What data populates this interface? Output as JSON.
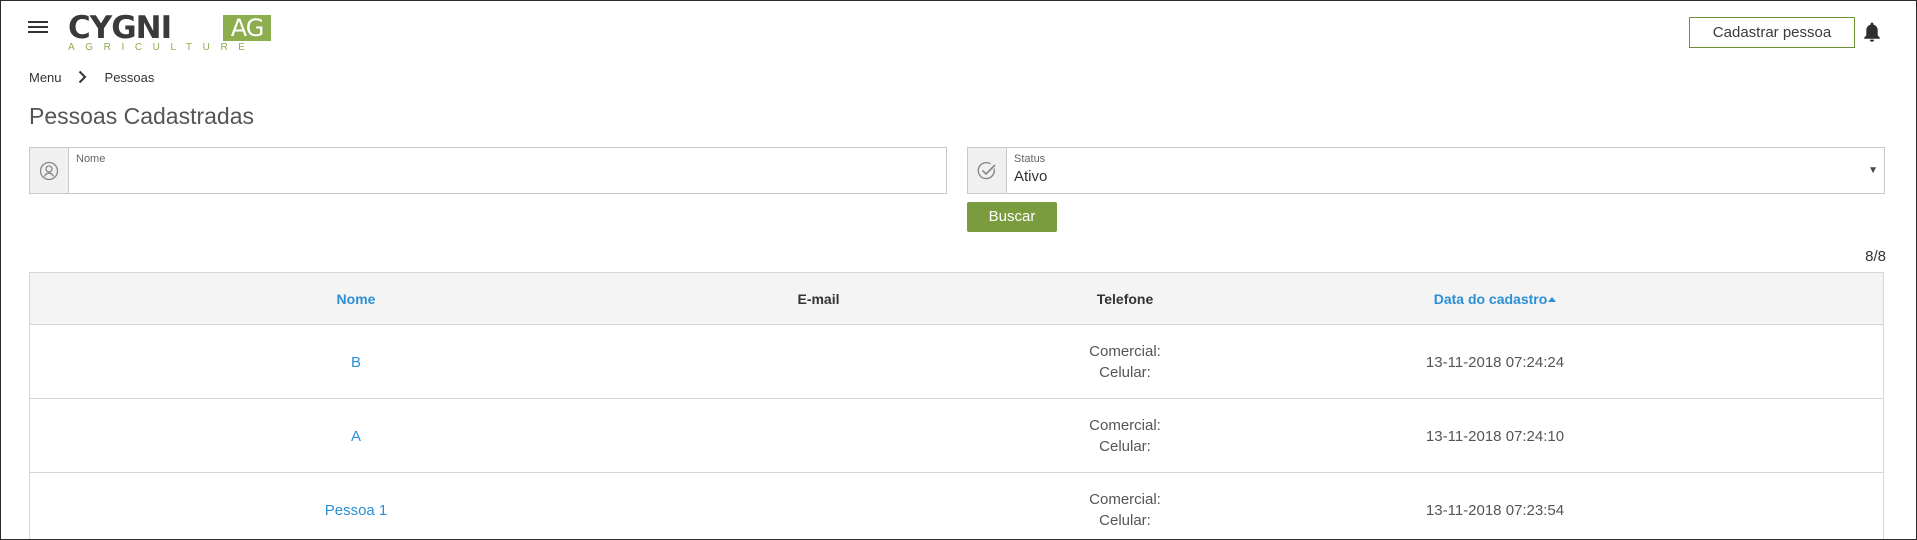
{
  "header": {
    "logo_word": "CYGNI",
    "logo_ag": "AG",
    "logo_sub": "AGRICULTURE",
    "cadastrar_label": "Cadastrar pessoa",
    "menu_icon": "hamburger-icon",
    "notifications_icon": "bell-icon"
  },
  "breadcrumb": {
    "items": [
      "Menu",
      "Pessoas"
    ],
    "separator_icon": "chevron-right-icon"
  },
  "page_title": "Pessoas Cadastradas",
  "filters": {
    "nome": {
      "label": "Nome",
      "value": "",
      "placeholder": "",
      "icon": "person-circle-icon"
    },
    "status": {
      "label": "Status",
      "value": "Ativo",
      "icon": "check-circle-icon"
    },
    "search_label": "Buscar"
  },
  "result_count": "8/8",
  "table": {
    "columns": [
      "Nome",
      "E-mail",
      "Telefone",
      "Data do cadastro"
    ],
    "sorted_column": "Data do cadastro",
    "sort_direction": "asc",
    "rows": [
      {
        "nome": "B",
        "email": "",
        "tel_comercial": "Comercial:",
        "tel_celular": "Celular:",
        "data": "13-11-2018 07:24:24"
      },
      {
        "nome": "A",
        "email": "",
        "tel_comercial": "Comercial:",
        "tel_celular": "Celular:",
        "data": "13-11-2018 07:24:10"
      },
      {
        "nome": "Pessoa 1",
        "email": "",
        "tel_comercial": "Comercial:",
        "tel_celular": "Celular:",
        "data": "13-11-2018 07:23:54"
      }
    ]
  },
  "colors": {
    "brand_green": "#8dae4f",
    "button_green": "#7a9c3f",
    "link_blue": "#2b8fd6"
  }
}
